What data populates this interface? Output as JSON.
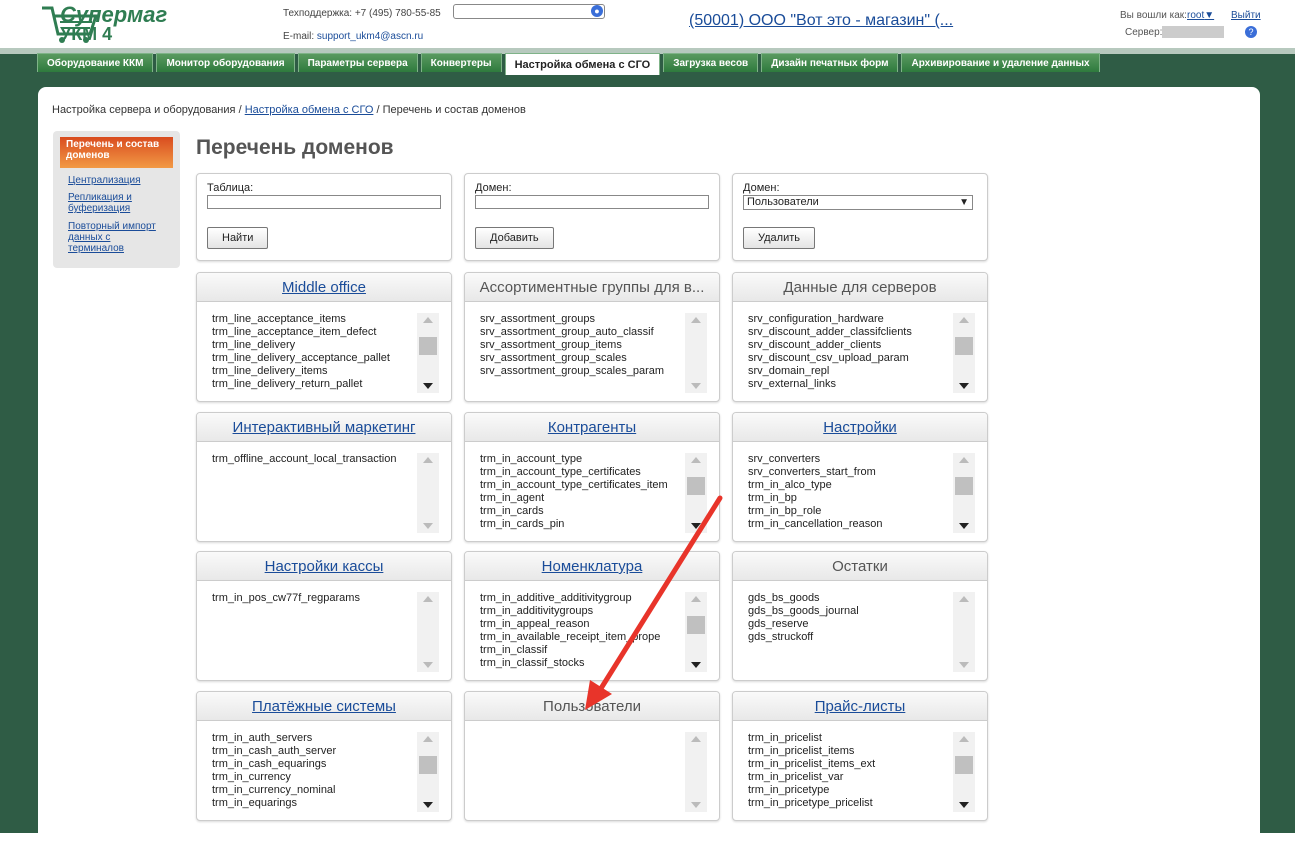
{
  "header": {
    "logo_line1": "Супермаг",
    "logo_line2": "УКМ 4",
    "support_label": "Техподдержка: +7 (495) 780-55-85",
    "email_label": "E-mail:",
    "email": "support_ukm4@ascn.ru",
    "company": "(50001) ООО \"Вот это - магазин\" (...",
    "logged_in_label": "Вы вошли как:",
    "user": "root",
    "logout": "Выйти",
    "server_label": "Сервер:"
  },
  "tabs": [
    {
      "label": "Оборудование ККМ",
      "active": false
    },
    {
      "label": "Монитор оборудования",
      "active": false
    },
    {
      "label": "Параметры сервера",
      "active": false
    },
    {
      "label": "Конвертеры",
      "active": false
    },
    {
      "label": "Настройка обмена с СГО",
      "active": true
    },
    {
      "label": "Загрузка весов",
      "active": false
    },
    {
      "label": "Дизайн печатных форм",
      "active": false
    },
    {
      "label": "Архивирование и удаление данных",
      "active": false
    }
  ],
  "breadcrumb": {
    "root": "Настройка сервера и оборудования",
    "sep": "/",
    "link": "Настройка обмена с СГО",
    "current": "Перечень и состав доменов"
  },
  "sidebar": {
    "active": "Перечень и состав доменов",
    "links": [
      "Централизация",
      "Репликация и буферизация",
      "Повторный импорт данных с терминалов"
    ]
  },
  "title": "Перечень доменов",
  "forms": {
    "table": {
      "label": "Таблица:",
      "value": "",
      "button": "Найти"
    },
    "domain_add": {
      "label": "Домен:",
      "value": "",
      "button": "Добавить"
    },
    "domain_delete": {
      "label": "Домен:",
      "selected": "Пользователи",
      "button": "Удалить"
    }
  },
  "domains": [
    {
      "title": "Middle office",
      "link": true,
      "items": [
        "trm_line_acceptance_items",
        "trm_line_acceptance_item_defect",
        "trm_line_delivery",
        "trm_line_delivery_acceptance_pallet",
        "trm_line_delivery_items",
        "trm_line_delivery_return_pallet"
      ]
    },
    {
      "title": "Ассортиментные группы для в...",
      "link": false,
      "items": [
        "srv_assortment_groups",
        "srv_assortment_group_auto_classif",
        "srv_assortment_group_items",
        "srv_assortment_group_scales",
        "srv_assortment_group_scales_param"
      ]
    },
    {
      "title": "Данные для серверов",
      "link": false,
      "items": [
        "srv_configuration_hardware",
        "srv_discount_adder_classifclients",
        "srv_discount_adder_clients",
        "srv_discount_csv_upload_param",
        "srv_domain_repl",
        "srv_external_links"
      ]
    },
    {
      "title": "Интерактивный маркетинг",
      "link": true,
      "items": [
        "trm_offline_account_local_transaction"
      ]
    },
    {
      "title": "Контрагенты",
      "link": true,
      "items": [
        "trm_in_account_type",
        "trm_in_account_type_certificates",
        "trm_in_account_type_certificates_item",
        "trm_in_agent",
        "trm_in_cards",
        "trm_in_cards_pin"
      ]
    },
    {
      "title": "Настройки",
      "link": true,
      "items": [
        "srv_converters",
        "srv_converters_start_from",
        "trm_in_alco_type",
        "trm_in_bp",
        "trm_in_bp_role",
        "trm_in_cancellation_reason"
      ]
    },
    {
      "title": "Настройки кассы",
      "link": true,
      "items": [
        "trm_in_pos_cw77f_regparams"
      ]
    },
    {
      "title": "Номенклатура",
      "link": true,
      "items": [
        "trm_in_additive_additivitygroup",
        "trm_in_additivitygroups",
        "trm_in_appeal_reason",
        "trm_in_available_receipt_item_prope",
        "trm_in_classif",
        "trm_in_classif_stocks"
      ]
    },
    {
      "title": "Остатки",
      "link": false,
      "items": [
        "gds_bs_goods",
        "gds_bs_goods_journal",
        "gds_reserve",
        "gds_struckoff"
      ]
    },
    {
      "title": "Платёжные системы",
      "link": true,
      "items": [
        "trm_in_auth_servers",
        "trm_in_cash_auth_server",
        "trm_in_cash_equarings",
        "trm_in_currency",
        "trm_in_currency_nominal",
        "trm_in_equarings"
      ]
    },
    {
      "title": "Пользователи",
      "link": false,
      "items": []
    },
    {
      "title": "Прайс-листы",
      "link": true,
      "items": [
        "trm_in_pricelist",
        "trm_in_pricelist_items",
        "trm_in_pricelist_items_ext",
        "trm_in_pricelist_var",
        "trm_in_pricetype",
        "trm_in_pricetype_pricelist"
      ]
    }
  ],
  "colors": {
    "brand_green": "#2f5c45",
    "tab_green": "#3f8a4a",
    "link": "#1a4c99",
    "arrow": "#e8342a",
    "sidebar_active": "#e06b2c"
  }
}
